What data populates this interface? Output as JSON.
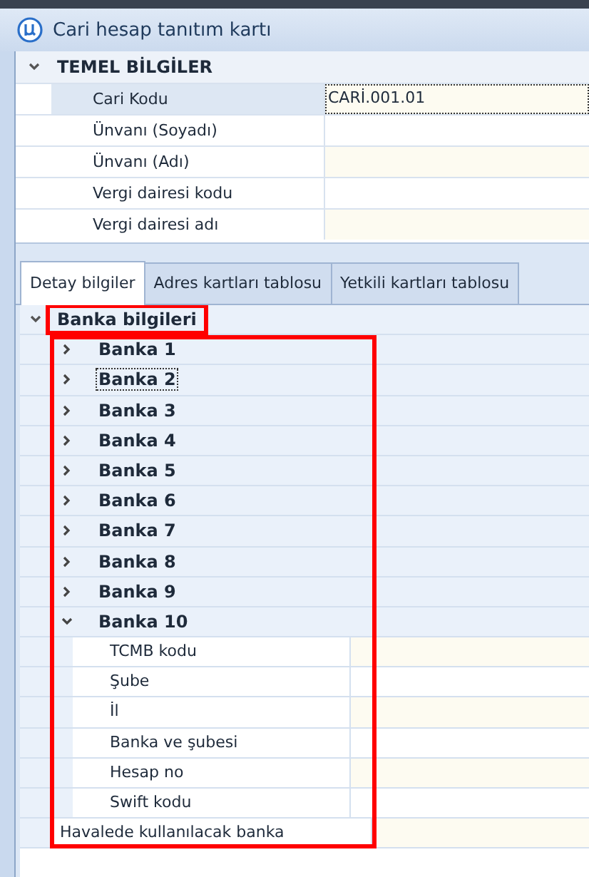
{
  "window": {
    "title": "Cari hesap tanıtım kartı"
  },
  "section": {
    "title": "TEMEL BİLGİLER",
    "expanded": true,
    "rows": [
      {
        "label": "Cari Kodu",
        "value": "CARİ.001.01",
        "selected": true
      },
      {
        "label": "Ünvanı (Soyadı)",
        "selected": false
      },
      {
        "label": "Ünvanı (Adı)",
        "selected": false
      },
      {
        "label": "Vergi dairesi kodu",
        "selected": false
      },
      {
        "label": "Vergi dairesi adı",
        "selected": false
      }
    ]
  },
  "tabs": [
    {
      "label": "Detay bilgiler",
      "selected": true
    },
    {
      "label": "Adres kartları tablosu",
      "selected": false
    },
    {
      "label": "Yetkili kartları tablosu",
      "selected": false
    }
  ],
  "tree": {
    "label": "Banka bilgileri",
    "expanded": true,
    "highlighted": true,
    "children_highlighted": true,
    "children": [
      {
        "kind": "group",
        "label": "Banka 1",
        "expanded": false,
        "focused": false
      },
      {
        "kind": "group",
        "label": "Banka 2",
        "expanded": false,
        "focused": true
      },
      {
        "kind": "group",
        "label": "Banka 3",
        "expanded": false,
        "focused": false
      },
      {
        "kind": "group",
        "label": "Banka 4",
        "expanded": false,
        "focused": false
      },
      {
        "kind": "group",
        "label": "Banka 5",
        "expanded": false,
        "focused": false
      },
      {
        "kind": "group",
        "label": "Banka 6",
        "expanded": false,
        "focused": false
      },
      {
        "kind": "group",
        "label": "Banka 7",
        "expanded": false,
        "focused": false
      },
      {
        "kind": "group",
        "label": "Banka 8",
        "expanded": false,
        "focused": false
      },
      {
        "kind": "group",
        "label": "Banka 9",
        "expanded": false,
        "focused": false
      },
      {
        "kind": "group",
        "label": "Banka 10",
        "expanded": true,
        "focused": false,
        "children": [
          {
            "kind": "field",
            "label": "TCMB kodu"
          },
          {
            "kind": "field",
            "label": "Şube"
          },
          {
            "kind": "field",
            "label": "İl"
          },
          {
            "kind": "field",
            "label": "Banka ve şubesi"
          },
          {
            "kind": "field",
            "label": "Hesap no"
          },
          {
            "kind": "field",
            "label": "Swift kodu"
          }
        ]
      },
      {
        "kind": "field",
        "label": "Havalede kullanılacak banka"
      }
    ]
  }
}
